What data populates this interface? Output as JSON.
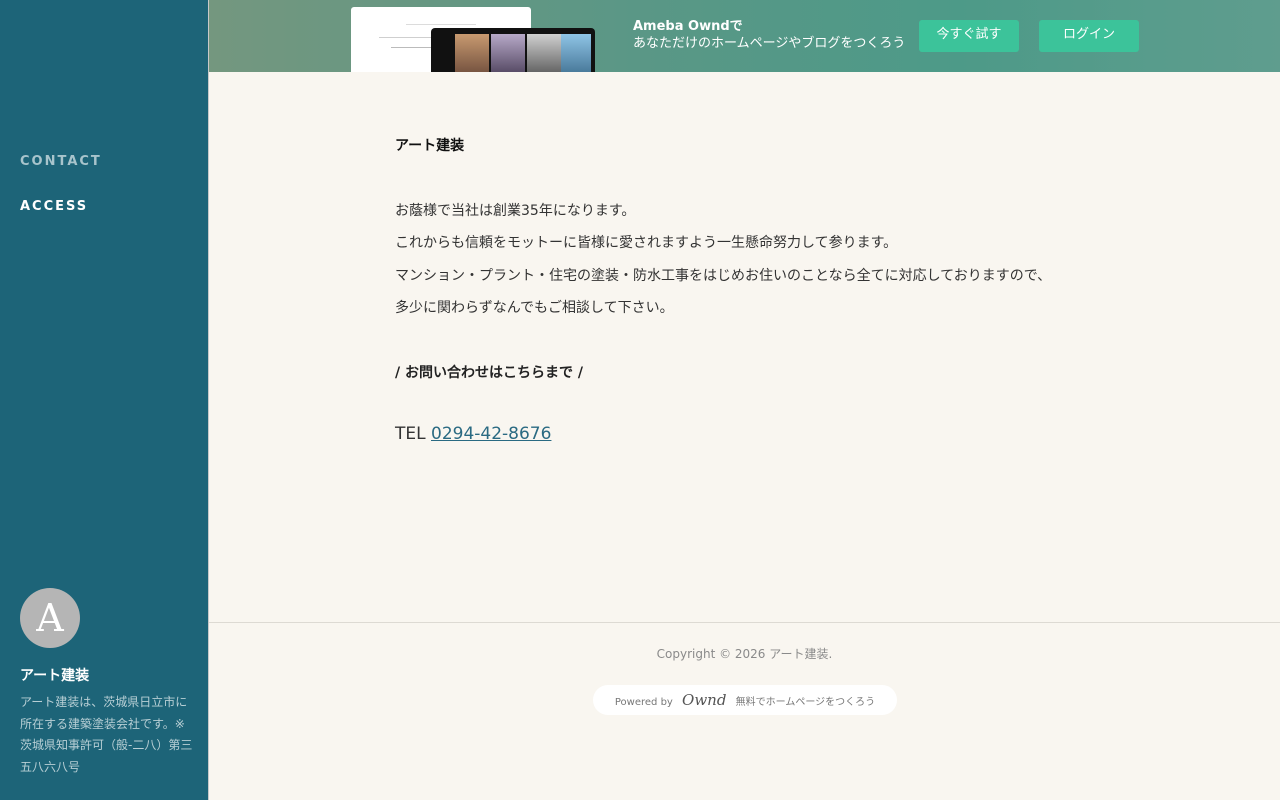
{
  "sidebar": {
    "nav": [
      {
        "label": "CONTACT"
      },
      {
        "label": "ACCESS"
      }
    ],
    "avatar_letter": "A",
    "site_name": "アート建装",
    "description": "アート建装は、茨城県日立市に所在する建築塗装会社です。※茨城県知事許可（般-二八）第三五八六八号"
  },
  "banner": {
    "line1": "Ameba Owndで",
    "line2": "あなただけのホームページやブログをつくろう",
    "try_button": "今すぐ試す",
    "login_button": "ログイン",
    "accent_color": "#3cc39a"
  },
  "main": {
    "title": "アート建装",
    "paragraphs": [
      "お蔭様で当社は創業35年になります。",
      "これからも信頼をモットーに皆様に愛されますよう一生懸命努力して参ります。",
      "マンション・プラント・住宅の塗装・防水工事をはじめお住いのことなら全てに対応しておりますので、",
      "多少に関わらずなんでもご相談して下さい。"
    ],
    "contact_heading": "/ お問い合わせはこちらまで /",
    "tel_label": "TEL",
    "tel_number": "0294-42-8676"
  },
  "footer": {
    "copyright": "Copyright © 2026 アート建装.",
    "powered_prefix": "Powered by",
    "powered_logo": "Ownd",
    "powered_suffix": "無料でホームページをつくろう"
  },
  "colors": {
    "sidebar_bg": "#1d6478",
    "page_bg": "#f9f6f0",
    "link": "#2a6a82"
  }
}
